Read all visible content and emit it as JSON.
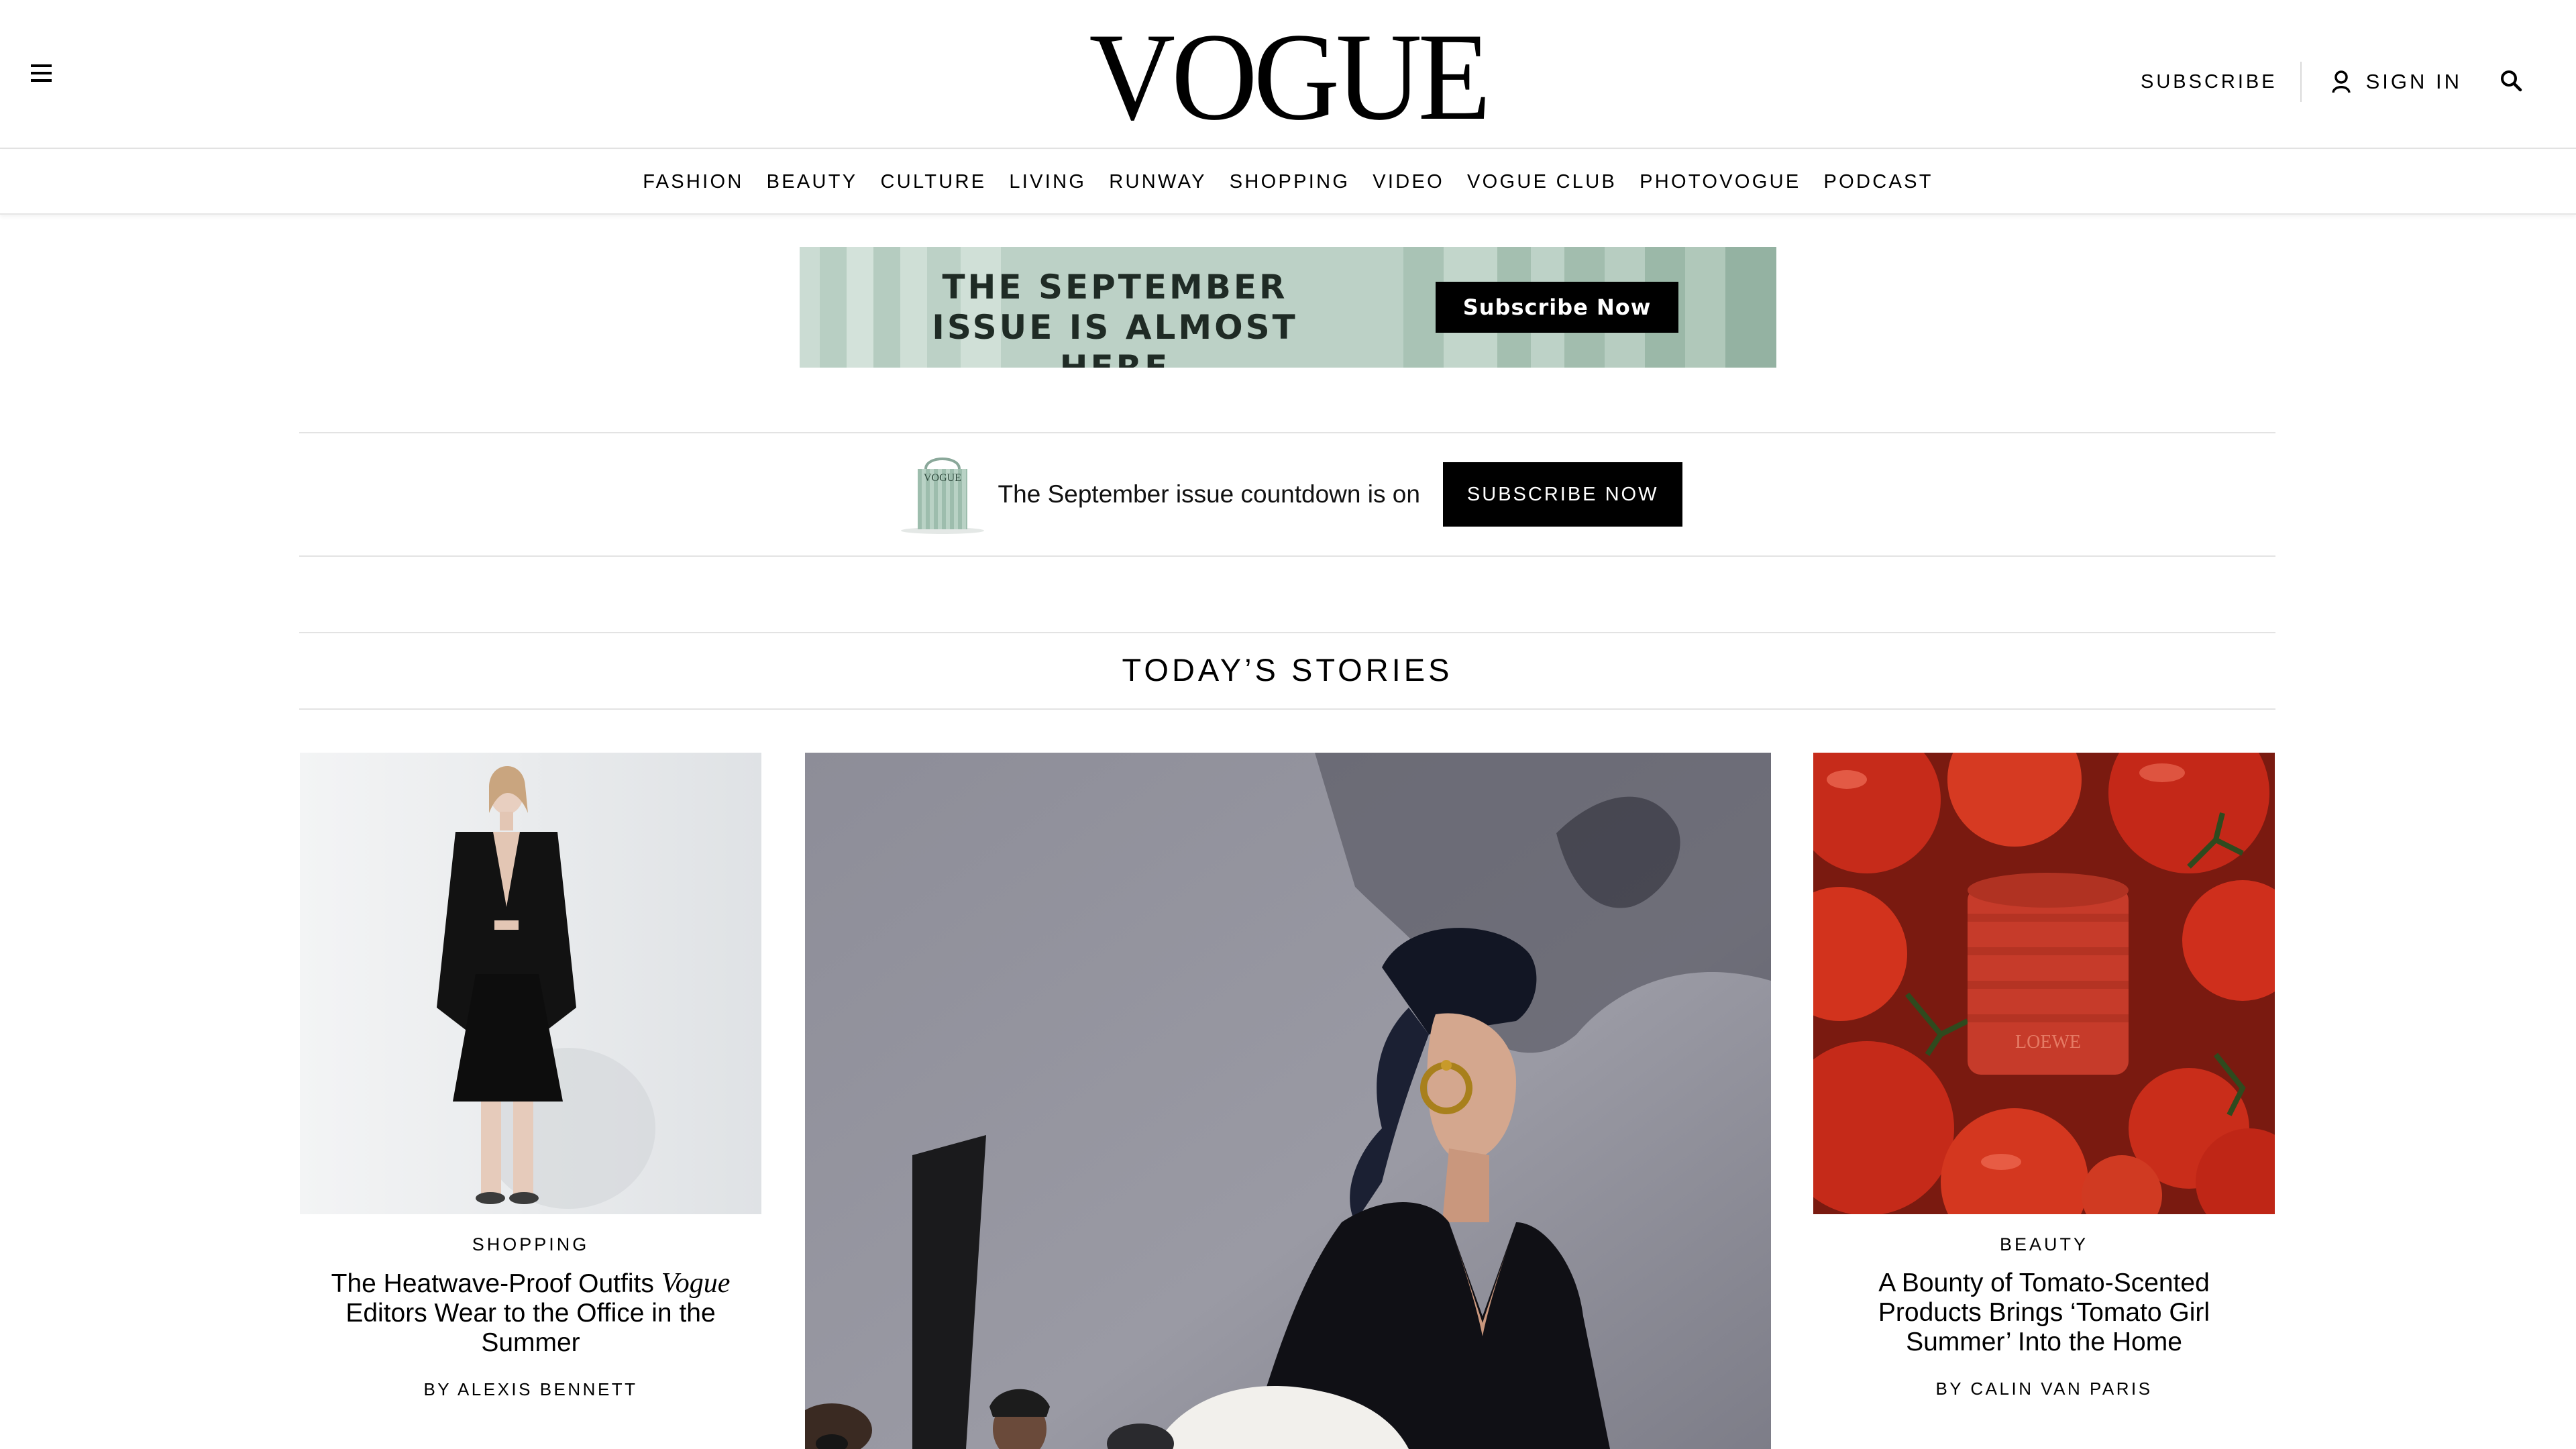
{
  "header": {
    "logo": "VOGUE",
    "subscribe_label": "SUBSCRIBE",
    "signin_label": "SIGN IN"
  },
  "nav": {
    "items": [
      "FASHION",
      "BEAUTY",
      "CULTURE",
      "LIVING",
      "RUNWAY",
      "SHOPPING",
      "VIDEO",
      "VOGUE CLUB",
      "PHOTOVOGUE",
      "PODCAST"
    ]
  },
  "banner": {
    "line1": "THE SEPTEMBER",
    "line2": "ISSUE IS ALMOST HERE",
    "cta": "Subscribe Now",
    "img_label": "VOGUE"
  },
  "promo": {
    "text": "The September issue countdown is on",
    "cta": "SUBSCRIBE NOW"
  },
  "stories": {
    "heading": "TODAY’S STORIES",
    "left": {
      "rubric": "SHOPPING",
      "title_before": "The Heatwave-Proof Outfits ",
      "title_italic": "Vogue",
      "title_after": " Editors Wear to the Office in the Summer",
      "byline": "BY ALEXIS BENNETT"
    },
    "right": {
      "rubric": "BEAUTY",
      "title": "A Bounty of Tomato-Scented Products Brings ‘Tomato Girl Summer’ Into the Home",
      "byline": "BY CALIN VAN PARIS",
      "candle_brand": "LOEWE"
    }
  },
  "colors": {
    "accent": "#000000",
    "banner_green": "#bcd1c6",
    "tomato": "#d8321f"
  },
  "icons": [
    "menu-icon",
    "user-icon",
    "search-icon"
  ]
}
